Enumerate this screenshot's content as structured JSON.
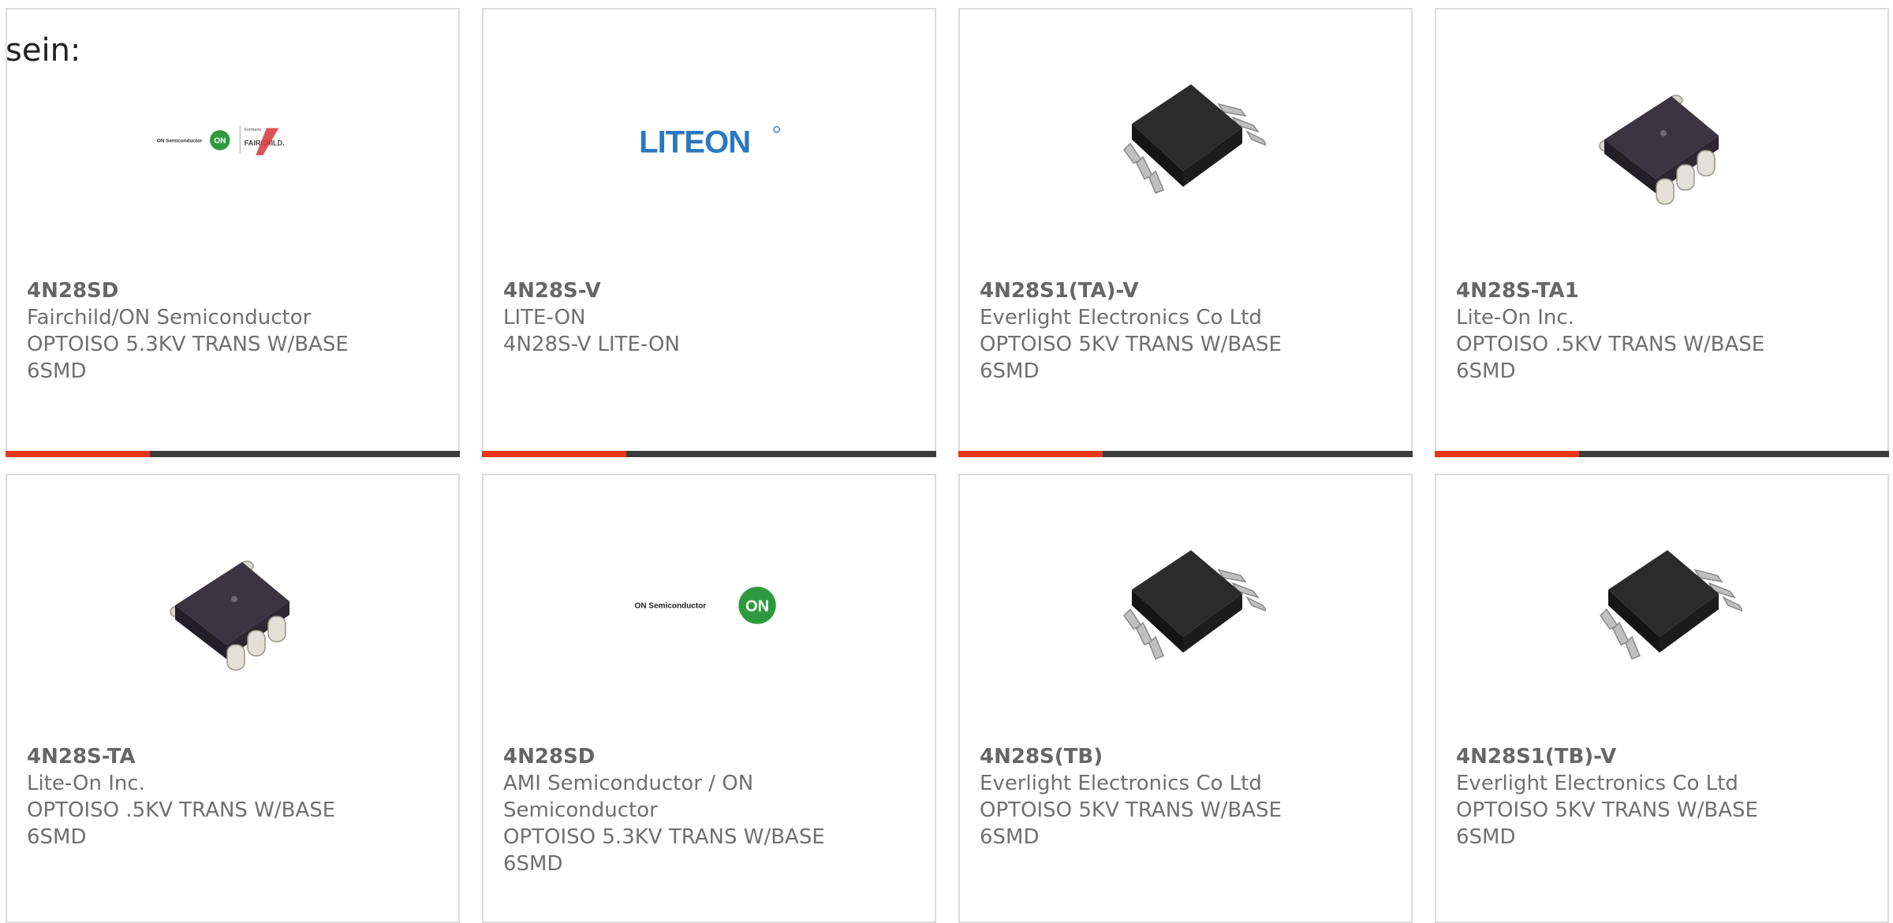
{
  "intro_text": "sein:",
  "colors": {
    "accent": "#e8381b",
    "bar": "#3c3c3c",
    "border": "#dcdcdc",
    "text": "#6f6f6f"
  },
  "products": [
    {
      "part_number": "4N28SD",
      "manufacturer": "Fairchild/ON Semiconductor",
      "description_line1": "OPTOISO 5.3KV TRANS W/BASE",
      "description_line2": "6SMD",
      "image_type": "fairchild-on-logo",
      "logo_small": "ON Semiconductor",
      "logo_formerly": "Formerly",
      "logo_brand": "FAIRCHILD."
    },
    {
      "part_number": "4N28S-V",
      "manufacturer": "LITE-ON",
      "description_line1": "4N28S-V LITE-ON",
      "description_line2": "",
      "image_type": "liteon-logo",
      "logo_brand": "LITEON"
    },
    {
      "part_number": "4N28S1(TA)-V",
      "manufacturer": "Everlight Electronics Co Ltd",
      "description_line1": "OPTOISO 5KV TRANS W/BASE",
      "description_line2": "6SMD",
      "image_type": "chip-gullwing"
    },
    {
      "part_number": "4N28S-TA1",
      "manufacturer": "Lite-On Inc.",
      "description_line1": "OPTOISO .5KV TRANS W/BASE",
      "description_line2": "6SMD",
      "image_type": "chip-rounded"
    },
    {
      "part_number": "4N28S-TA",
      "manufacturer": "Lite-On Inc.",
      "description_line1": "OPTOISO .5KV TRANS W/BASE",
      "description_line2": "6SMD",
      "image_type": "chip-rounded"
    },
    {
      "part_number": "4N28SD",
      "manufacturer": "AMI Semiconductor / ON Semiconductor",
      "description_line1": "OPTOISO 5.3KV TRANS W/BASE",
      "description_line2": "6SMD",
      "image_type": "on-semi-logo",
      "logo_small": "ON Semiconductor"
    },
    {
      "part_number": "4N28S(TB)",
      "manufacturer": "Everlight Electronics Co Ltd",
      "description_line1": "OPTOISO 5KV TRANS W/BASE",
      "description_line2": "6SMD",
      "image_type": "chip-gullwing"
    },
    {
      "part_number": "4N28S1(TB)-V",
      "manufacturer": "Everlight Electronics Co Ltd",
      "description_line1": "OPTOISO 5KV TRANS W/BASE",
      "description_line2": "6SMD",
      "image_type": "chip-gullwing"
    }
  ]
}
